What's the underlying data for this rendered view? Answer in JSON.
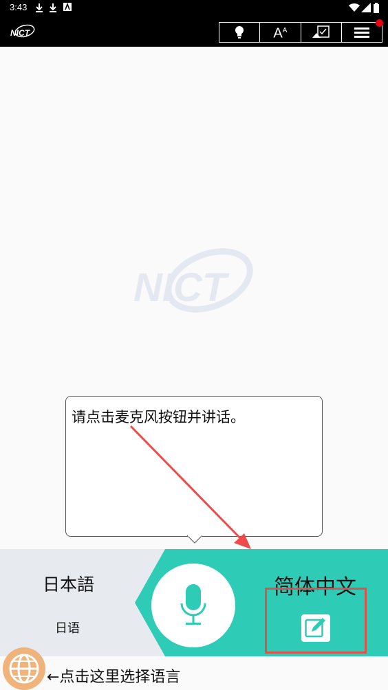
{
  "status": {
    "time": "3:43"
  },
  "app": {
    "logo_text": "NICT",
    "watermark_text": "NICT"
  },
  "toolbar": {
    "font_label": "A"
  },
  "tooltip": {
    "text": "请点击麦克风按钮并讲话。"
  },
  "languages": {
    "left": {
      "name": "日本語",
      "subtitle": "日语"
    },
    "right": {
      "name": "简体中文"
    }
  },
  "footer": {
    "hint": "←点击这里选择语言"
  },
  "colors": {
    "teal": "#2ecbb6",
    "accent_red": "#e8000f",
    "globe": "#f0b37c"
  },
  "icons": [
    "lightbulb-icon",
    "font-size-icon",
    "history-icon",
    "menu-icon",
    "mic-icon",
    "edit-icon",
    "globe-icon"
  ]
}
